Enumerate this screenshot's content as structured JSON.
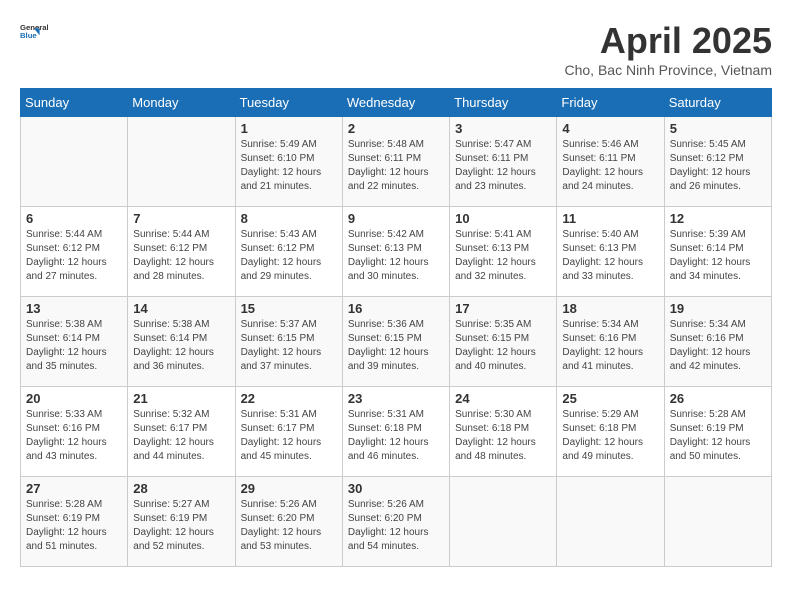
{
  "header": {
    "logo_line1": "General",
    "logo_line2": "Blue",
    "title": "April 2025",
    "subtitle": "Cho, Bac Ninh Province, Vietnam"
  },
  "calendar": {
    "days_of_week": [
      "Sunday",
      "Monday",
      "Tuesday",
      "Wednesday",
      "Thursday",
      "Friday",
      "Saturday"
    ],
    "weeks": [
      [
        {
          "day": "",
          "sunrise": "",
          "sunset": "",
          "daylight": ""
        },
        {
          "day": "",
          "sunrise": "",
          "sunset": "",
          "daylight": ""
        },
        {
          "day": "1",
          "sunrise": "Sunrise: 5:49 AM",
          "sunset": "Sunset: 6:10 PM",
          "daylight": "Daylight: 12 hours and 21 minutes."
        },
        {
          "day": "2",
          "sunrise": "Sunrise: 5:48 AM",
          "sunset": "Sunset: 6:11 PM",
          "daylight": "Daylight: 12 hours and 22 minutes."
        },
        {
          "day": "3",
          "sunrise": "Sunrise: 5:47 AM",
          "sunset": "Sunset: 6:11 PM",
          "daylight": "Daylight: 12 hours and 23 minutes."
        },
        {
          "day": "4",
          "sunrise": "Sunrise: 5:46 AM",
          "sunset": "Sunset: 6:11 PM",
          "daylight": "Daylight: 12 hours and 24 minutes."
        },
        {
          "day": "5",
          "sunrise": "Sunrise: 5:45 AM",
          "sunset": "Sunset: 6:12 PM",
          "daylight": "Daylight: 12 hours and 26 minutes."
        }
      ],
      [
        {
          "day": "6",
          "sunrise": "Sunrise: 5:44 AM",
          "sunset": "Sunset: 6:12 PM",
          "daylight": "Daylight: 12 hours and 27 minutes."
        },
        {
          "day": "7",
          "sunrise": "Sunrise: 5:44 AM",
          "sunset": "Sunset: 6:12 PM",
          "daylight": "Daylight: 12 hours and 28 minutes."
        },
        {
          "day": "8",
          "sunrise": "Sunrise: 5:43 AM",
          "sunset": "Sunset: 6:12 PM",
          "daylight": "Daylight: 12 hours and 29 minutes."
        },
        {
          "day": "9",
          "sunrise": "Sunrise: 5:42 AM",
          "sunset": "Sunset: 6:13 PM",
          "daylight": "Daylight: 12 hours and 30 minutes."
        },
        {
          "day": "10",
          "sunrise": "Sunrise: 5:41 AM",
          "sunset": "Sunset: 6:13 PM",
          "daylight": "Daylight: 12 hours and 32 minutes."
        },
        {
          "day": "11",
          "sunrise": "Sunrise: 5:40 AM",
          "sunset": "Sunset: 6:13 PM",
          "daylight": "Daylight: 12 hours and 33 minutes."
        },
        {
          "day": "12",
          "sunrise": "Sunrise: 5:39 AM",
          "sunset": "Sunset: 6:14 PM",
          "daylight": "Daylight: 12 hours and 34 minutes."
        }
      ],
      [
        {
          "day": "13",
          "sunrise": "Sunrise: 5:38 AM",
          "sunset": "Sunset: 6:14 PM",
          "daylight": "Daylight: 12 hours and 35 minutes."
        },
        {
          "day": "14",
          "sunrise": "Sunrise: 5:38 AM",
          "sunset": "Sunset: 6:14 PM",
          "daylight": "Daylight: 12 hours and 36 minutes."
        },
        {
          "day": "15",
          "sunrise": "Sunrise: 5:37 AM",
          "sunset": "Sunset: 6:15 PM",
          "daylight": "Daylight: 12 hours and 37 minutes."
        },
        {
          "day": "16",
          "sunrise": "Sunrise: 5:36 AM",
          "sunset": "Sunset: 6:15 PM",
          "daylight": "Daylight: 12 hours and 39 minutes."
        },
        {
          "day": "17",
          "sunrise": "Sunrise: 5:35 AM",
          "sunset": "Sunset: 6:15 PM",
          "daylight": "Daylight: 12 hours and 40 minutes."
        },
        {
          "day": "18",
          "sunrise": "Sunrise: 5:34 AM",
          "sunset": "Sunset: 6:16 PM",
          "daylight": "Daylight: 12 hours and 41 minutes."
        },
        {
          "day": "19",
          "sunrise": "Sunrise: 5:34 AM",
          "sunset": "Sunset: 6:16 PM",
          "daylight": "Daylight: 12 hours and 42 minutes."
        }
      ],
      [
        {
          "day": "20",
          "sunrise": "Sunrise: 5:33 AM",
          "sunset": "Sunset: 6:16 PM",
          "daylight": "Daylight: 12 hours and 43 minutes."
        },
        {
          "day": "21",
          "sunrise": "Sunrise: 5:32 AM",
          "sunset": "Sunset: 6:17 PM",
          "daylight": "Daylight: 12 hours and 44 minutes."
        },
        {
          "day": "22",
          "sunrise": "Sunrise: 5:31 AM",
          "sunset": "Sunset: 6:17 PM",
          "daylight": "Daylight: 12 hours and 45 minutes."
        },
        {
          "day": "23",
          "sunrise": "Sunrise: 5:31 AM",
          "sunset": "Sunset: 6:18 PM",
          "daylight": "Daylight: 12 hours and 46 minutes."
        },
        {
          "day": "24",
          "sunrise": "Sunrise: 5:30 AM",
          "sunset": "Sunset: 6:18 PM",
          "daylight": "Daylight: 12 hours and 48 minutes."
        },
        {
          "day": "25",
          "sunrise": "Sunrise: 5:29 AM",
          "sunset": "Sunset: 6:18 PM",
          "daylight": "Daylight: 12 hours and 49 minutes."
        },
        {
          "day": "26",
          "sunrise": "Sunrise: 5:28 AM",
          "sunset": "Sunset: 6:19 PM",
          "daylight": "Daylight: 12 hours and 50 minutes."
        }
      ],
      [
        {
          "day": "27",
          "sunrise": "Sunrise: 5:28 AM",
          "sunset": "Sunset: 6:19 PM",
          "daylight": "Daylight: 12 hours and 51 minutes."
        },
        {
          "day": "28",
          "sunrise": "Sunrise: 5:27 AM",
          "sunset": "Sunset: 6:19 PM",
          "daylight": "Daylight: 12 hours and 52 minutes."
        },
        {
          "day": "29",
          "sunrise": "Sunrise: 5:26 AM",
          "sunset": "Sunset: 6:20 PM",
          "daylight": "Daylight: 12 hours and 53 minutes."
        },
        {
          "day": "30",
          "sunrise": "Sunrise: 5:26 AM",
          "sunset": "Sunset: 6:20 PM",
          "daylight": "Daylight: 12 hours and 54 minutes."
        },
        {
          "day": "",
          "sunrise": "",
          "sunset": "",
          "daylight": ""
        },
        {
          "day": "",
          "sunrise": "",
          "sunset": "",
          "daylight": ""
        },
        {
          "day": "",
          "sunrise": "",
          "sunset": "",
          "daylight": ""
        }
      ]
    ]
  }
}
